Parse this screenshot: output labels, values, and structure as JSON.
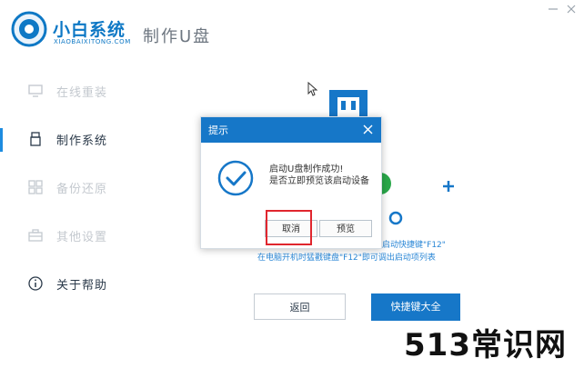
{
  "app": {
    "brand": "小白系统",
    "brand_sub": "XIAOBAIXITONG.COM",
    "page_title": "制作U盘"
  },
  "sidebar": {
    "items": [
      {
        "label": "在线重装",
        "icon": "monitor-icon",
        "active": false
      },
      {
        "label": "制作系统",
        "icon": "usb-drive-icon",
        "active": true
      },
      {
        "label": "备份还原",
        "icon": "backup-grid-icon",
        "active": false
      },
      {
        "label": "其他设置",
        "icon": "toolbox-icon",
        "active": false
      },
      {
        "label": "关于帮助",
        "icon": "info-icon",
        "active": false
      }
    ]
  },
  "dialog": {
    "title": "提示",
    "message_line1": "启动U盘制作成功!",
    "message_line2": "是否立即预览该启动设备",
    "cancel_label": "取消",
    "preview_label": "预览",
    "icon": "success-check-icon"
  },
  "hints": {
    "line1": "启动快捷键\"F12\"",
    "line2": "在电脑开机时猛戳键盘\"F12\"即可调出启动项列表"
  },
  "buttons": {
    "back_label": "返回",
    "hotkey_label": "快捷键大全"
  },
  "watermark": "513常识网",
  "colors": {
    "brand": "#0e78c5",
    "accent": "#1677c8",
    "highlight_box": "#e0262e"
  }
}
